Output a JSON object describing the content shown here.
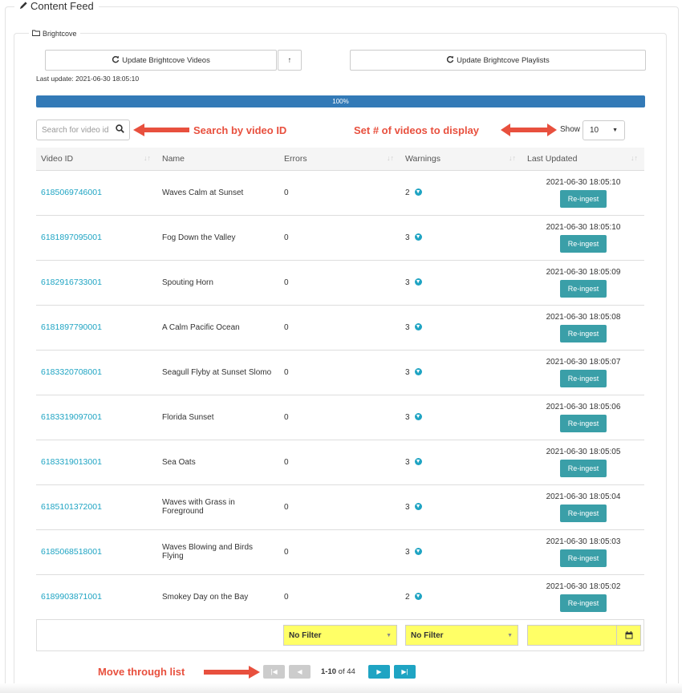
{
  "content_feed": {
    "title": "Content Feed",
    "pencil_icon": "pencil-icon"
  },
  "brightcove": {
    "legend": "Brightcove",
    "folder_icon": "folder-icon",
    "update_videos_label": "Update Brightcove Videos",
    "update_playlists_label": "Update Brightcove Playlists",
    "up_icon": "↑",
    "last_update": "Last update: 2021-06-30 18:05:10",
    "progress_value": 100,
    "progress_label": "100%"
  },
  "search": {
    "placeholder": "Search for video id",
    "annotation": "Search by video ID"
  },
  "show": {
    "label": "Show",
    "value": "10",
    "annotation": "Set # of videos to display"
  },
  "table": {
    "headers": [
      "Video ID",
      "Name",
      "Errors",
      "Warnings",
      "Last Updated"
    ],
    "reingest_label": "Re-ingest",
    "rows": [
      {
        "id": "6185069746001",
        "name": "Waves Calm at Sunset",
        "errors": "0",
        "warnings": "2",
        "updated": "2021-06-30 18:05:10"
      },
      {
        "id": "6181897095001",
        "name": "Fog Down the Valley",
        "errors": "0",
        "warnings": "3",
        "updated": "2021-06-30 18:05:10"
      },
      {
        "id": "6182916733001",
        "name": "Spouting Horn",
        "errors": "0",
        "warnings": "3",
        "updated": "2021-06-30 18:05:09"
      },
      {
        "id": "6181897790001",
        "name": "A Calm Pacific Ocean",
        "errors": "0",
        "warnings": "3",
        "updated": "2021-06-30 18:05:08"
      },
      {
        "id": "6183320708001",
        "name": "Seagull Flyby at Sunset Slomo",
        "errors": "0",
        "warnings": "3",
        "updated": "2021-06-30 18:05:07"
      },
      {
        "id": "6183319097001",
        "name": "Florida Sunset",
        "errors": "0",
        "warnings": "3",
        "updated": "2021-06-30 18:05:06"
      },
      {
        "id": "6183319013001",
        "name": "Sea Oats",
        "errors": "0",
        "warnings": "3",
        "updated": "2021-06-30 18:05:05"
      },
      {
        "id": "6185101372001",
        "name": "Waves with Grass in Foreground",
        "errors": "0",
        "warnings": "3",
        "updated": "2021-06-30 18:05:04"
      },
      {
        "id": "6185068518001",
        "name": "Waves Blowing and Birds Flying",
        "errors": "0",
        "warnings": "3",
        "updated": "2021-06-30 18:05:03"
      },
      {
        "id": "6189903871001",
        "name": "Smokey Day on the Bay",
        "errors": "0",
        "warnings": "2",
        "updated": "2021-06-30 18:05:02"
      }
    ]
  },
  "filters": {
    "errors_filter": "No Filter",
    "warnings_filter": "No Filter",
    "date_filter": ""
  },
  "pager": {
    "text": "1-10",
    "of": "of 44",
    "annotation": "Move through list"
  },
  "colors": {
    "accent": "#1fa4c3",
    "annotation": "#e8503e",
    "progress": "#337ab7",
    "reingest": "#3a9fa8",
    "filter_highlight": "#ffff66"
  }
}
